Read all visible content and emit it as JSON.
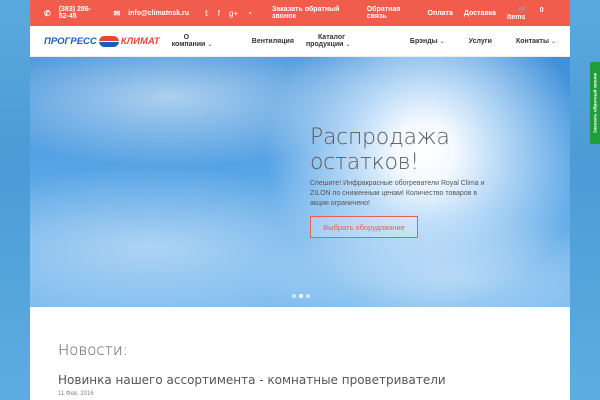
{
  "topbar": {
    "phone": "(383) 286-52-45",
    "email": "info@climatnsk.ru",
    "social_icons": [
      "twitter-icon",
      "facebook-icon",
      "google-plus-icon",
      "rss-icon"
    ],
    "links": [
      "Заказать обратный звонок",
      "Обратная связь",
      "Оплата",
      "Доставка"
    ],
    "cart": "0 Items"
  },
  "logo": {
    "word1": "ПРОГРЕСС",
    "word2": "КЛИМАТ"
  },
  "nav": {
    "items": [
      {
        "label": "О компании",
        "dropdown": true
      },
      {
        "label": "Вентиляция",
        "dropdown": false
      },
      {
        "label": "Каталог продукции",
        "dropdown": true
      },
      {
        "label": "Брэнды",
        "dropdown": true
      },
      {
        "label": "Услуги",
        "dropdown": false
      },
      {
        "label": "Контакты",
        "dropdown": true
      }
    ]
  },
  "hero": {
    "title_line1": "Распродажа",
    "title_line2": "остатков!",
    "description": "Спешите! Инфракрасные обогреватели Royal Clima и ZILON по сниженным ценам! Количество товаров в акции ограничено!",
    "cta": "Выбрать оборудование",
    "slides_count": 3,
    "active_slide": 2
  },
  "news": {
    "heading": "Новости:",
    "item_title": "Новинка нашего ассортимента - комнатные проветриватели",
    "item_date": "11 Фев, 2016"
  },
  "side_tab": "Заказать обратный звонок",
  "colors": {
    "accent": "#f25c4d",
    "side_tab": "#1f9d3a",
    "logo_blue": "#1b5fb4"
  }
}
